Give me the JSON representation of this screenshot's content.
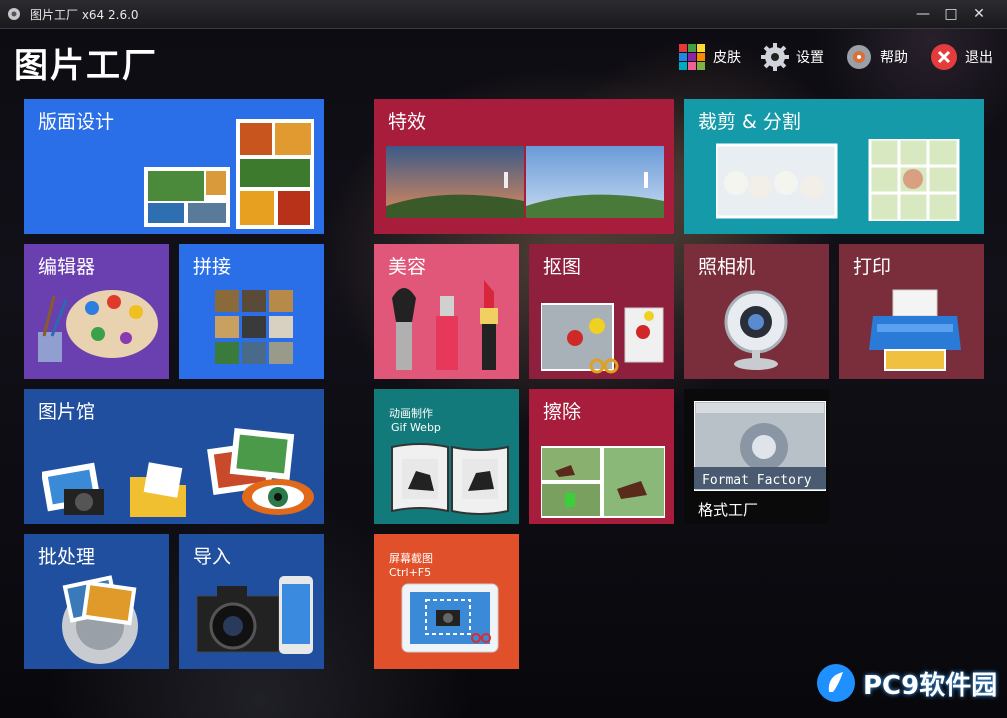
{
  "window": {
    "title": "图片工厂 x64 2.6.0"
  },
  "window_controls": {
    "minimize": "—",
    "maximize": "□",
    "close": "✕"
  },
  "header": {
    "app_name": "图片工厂"
  },
  "menu": {
    "skin": "皮肤",
    "settings": "设置",
    "help": "帮助",
    "exit": "退出"
  },
  "tiles": {
    "layout_design": "版面设计",
    "effects": "特效",
    "crop_split": "裁剪 & 分割",
    "editor": "编辑器",
    "stitch": "拼接",
    "beauty": "美容",
    "cutout": "抠图",
    "camera": "照相机",
    "print": "打印",
    "gallery": "图片馆",
    "animation": "动画制作",
    "animation_sub": "Gif Webp",
    "erase": "擦除",
    "format_factory": "格式工厂",
    "format_factory_logo": "Format Factory",
    "batch": "批处理",
    "import": "导入",
    "screenshot": "屏幕截图",
    "screenshot_shortcut": "Ctrl+F5"
  },
  "watermark": {
    "text": "PC9软件园"
  },
  "colors": {
    "blue": "#2b6fe8",
    "purple": "#6a3fb0",
    "navy": "#1f4f9e",
    "crimson": "#a81d3c",
    "teal": "#149aa8",
    "pink": "#e0577a",
    "maroon": "#8e1f3d",
    "wine": "#7a2e3c",
    "dark_teal": "#127a7a",
    "orange": "#e0502a",
    "black": "#0a0a0a"
  }
}
